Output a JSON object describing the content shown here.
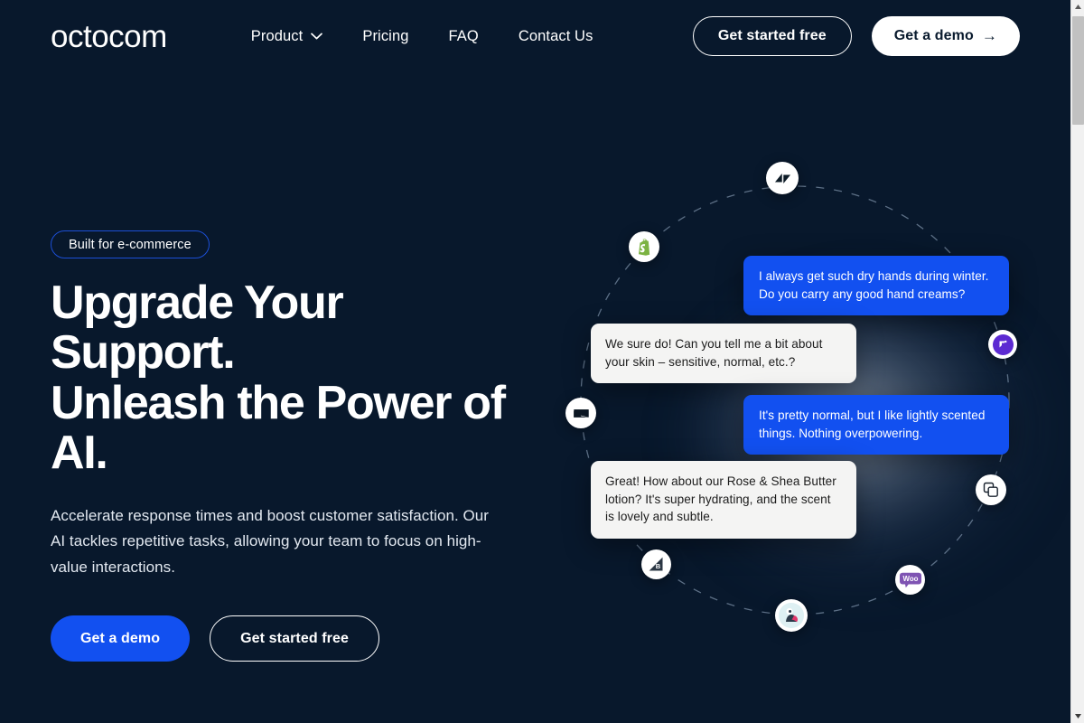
{
  "brand": {
    "logo_text": "octocom",
    "accent_blue": "#1250f0",
    "badge_border": "#1c4fd6",
    "background": "#08182c"
  },
  "header": {
    "nav": [
      {
        "label": "Product",
        "has_dropdown": true,
        "icon": "chevron-down-icon"
      },
      {
        "label": "Pricing",
        "has_dropdown": false
      },
      {
        "label": "FAQ",
        "has_dropdown": false
      },
      {
        "label": "Contact Us",
        "has_dropdown": false
      }
    ],
    "cta_outline": "Get started free",
    "cta_filled": "Get a demo",
    "cta_filled_icon": "arrow-right-icon",
    "cta_filled_arrow": "→"
  },
  "hero": {
    "badge": "Built for e-commerce",
    "title_line1": "Upgrade Your Support.",
    "title_line2": "Unleash the Power of",
    "title_line3": "AI.",
    "subtitle": "Accelerate response times and boost customer satisfaction. Our AI tackles repetitive tasks, allowing your team to focus on high-value interactions.",
    "cta_primary": "Get a demo",
    "cta_secondary": "Get started free"
  },
  "conversation": [
    {
      "role": "user",
      "text": "I always get such dry hands during winter. Do you carry any good hand creams?"
    },
    {
      "role": "bot",
      "text": "We sure do! Can you tell me a bit about your skin – sensitive, normal, etc.?"
    },
    {
      "role": "user",
      "text": "It's pretty normal, but I like lightly scented things. Nothing overpowering."
    },
    {
      "role": "bot",
      "text": "Great! How about our Rose & Shea Butter lotion? It's super hydrating, and the scent is lovely and subtle."
    }
  ],
  "integrations": [
    {
      "name": "Zendesk",
      "icon": "zendesk-icon"
    },
    {
      "name": "Shopify",
      "icon": "shopify-icon"
    },
    {
      "name": "Gorgias",
      "icon": "gorgias-icon"
    },
    {
      "name": "Klaviyo",
      "icon": "klaviyo-icon"
    },
    {
      "name": "Intercom",
      "icon": "intercom-icon"
    },
    {
      "name": "WooCommerce",
      "icon": "woocommerce-icon"
    },
    {
      "name": "PrestaShop",
      "icon": "prestashop-icon"
    },
    {
      "name": "BigCommerce",
      "icon": "bigcommerce-icon"
    }
  ],
  "scrollbar": {
    "up_arrow": "▲",
    "down_arrow": "▼"
  }
}
